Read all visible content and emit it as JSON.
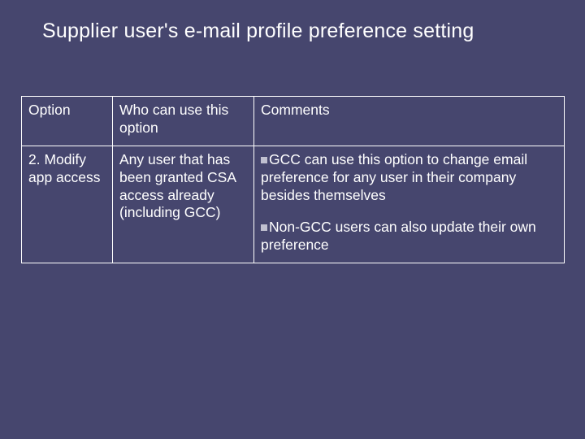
{
  "title": "Supplier user's e-mail profile preference setting",
  "table": {
    "headers": {
      "option": "Option",
      "who": "Who can use this option",
      "comments": "Comments"
    },
    "row": {
      "option": "2. Modify app access",
      "who": "Any user that has been granted CSA access already (including GCC)",
      "comments_p1": "GCC can use this option to change email preference for any user in their company besides themselves",
      "comments_p2": "Non-GCC users can also update their own preference"
    }
  }
}
